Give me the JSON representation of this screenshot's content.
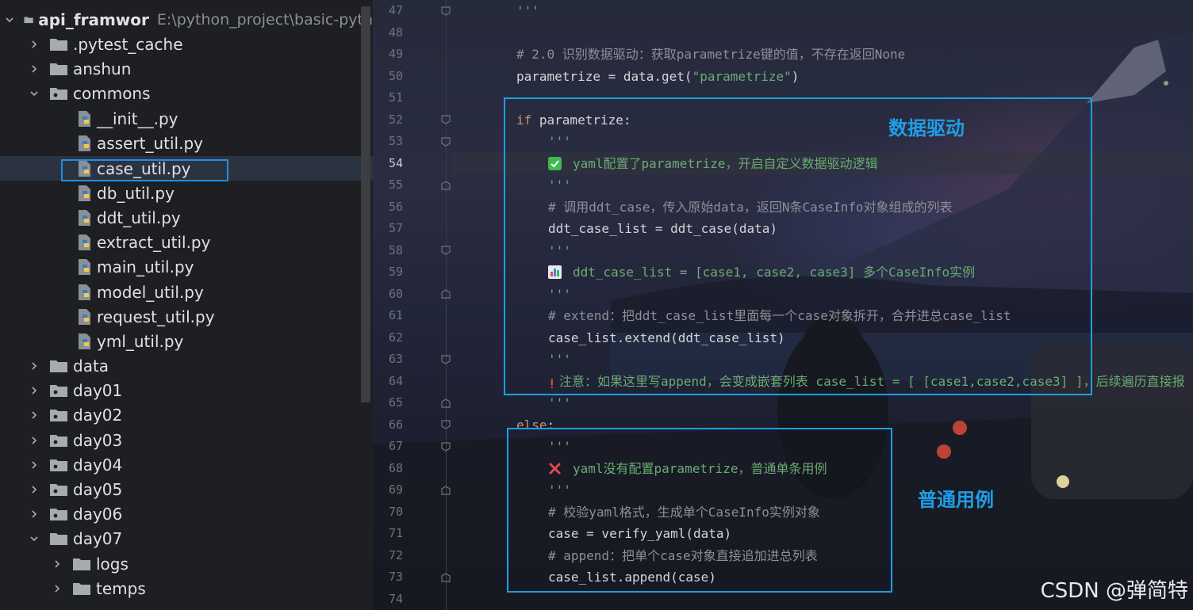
{
  "tree": {
    "root": {
      "name": "api_framwor",
      "path": "E:\\python_project\\basic-pyth"
    },
    "items": [
      {
        "label": ".pytest_cache",
        "kind": "folder"
      },
      {
        "label": "anshun",
        "kind": "folder"
      },
      {
        "label": "commons",
        "kind": "folder",
        "expanded": true
      },
      {
        "label": "__init__.py",
        "kind": "python-file"
      },
      {
        "label": "assert_util.py",
        "kind": "python-file"
      },
      {
        "label": "case_util.py",
        "kind": "python-file",
        "selected": true
      },
      {
        "label": "db_util.py",
        "kind": "python-file"
      },
      {
        "label": "ddt_util.py",
        "kind": "python-file"
      },
      {
        "label": "extract_util.py",
        "kind": "python-file"
      },
      {
        "label": "main_util.py",
        "kind": "python-file"
      },
      {
        "label": "model_util.py",
        "kind": "python-file"
      },
      {
        "label": "request_util.py",
        "kind": "python-file"
      },
      {
        "label": "yml_util.py",
        "kind": "python-file"
      },
      {
        "label": "data",
        "kind": "folder"
      },
      {
        "label": "day01",
        "kind": "folder"
      },
      {
        "label": "day02",
        "kind": "folder"
      },
      {
        "label": "day03",
        "kind": "folder"
      },
      {
        "label": "day04",
        "kind": "folder"
      },
      {
        "label": "day05",
        "kind": "folder"
      },
      {
        "label": "day06",
        "kind": "folder"
      },
      {
        "label": "day07",
        "kind": "folder",
        "expanded": true
      },
      {
        "label": "logs",
        "kind": "folder"
      },
      {
        "label": "temps",
        "kind": "folder"
      }
    ]
  },
  "editor": {
    "lines": [
      {
        "n": "47",
        "text": "'''"
      },
      {
        "n": "48",
        "text": ""
      },
      {
        "n": "49",
        "text": "# 2.0 识别数据驱动：获取parametrize键的值，不存在返回None"
      },
      {
        "n": "50",
        "text_a": "parametrize = data.get(",
        "text_b": "\"parametrize\"",
        "text_c": ")"
      },
      {
        "n": "51",
        "text": ""
      },
      {
        "n": "52",
        "kw": "if",
        "text": " parametrize:"
      },
      {
        "n": "53",
        "text": "'''"
      },
      {
        "n": "54",
        "text": "yaml配置了parametrize，开启自定义数据驱动逻辑"
      },
      {
        "n": "55",
        "text": "'''"
      },
      {
        "n": "56",
        "text": "# 调用ddt_case，传入原始data，返回N条CaseInfo对象组成的列表"
      },
      {
        "n": "57",
        "text": "ddt_case_list = ddt_case(data)"
      },
      {
        "n": "58",
        "text": "'''"
      },
      {
        "n": "59",
        "text": "ddt_case_list = [case1, case2, case3] 多个CaseInfo实例"
      },
      {
        "n": "60",
        "text": "'''"
      },
      {
        "n": "61",
        "text": "# extend：把ddt_case_list里面每一个case对象拆开，合并进总case_list"
      },
      {
        "n": "62",
        "text": "case_list.extend(ddt_case_list)"
      },
      {
        "n": "63",
        "text": "'''"
      },
      {
        "n": "64",
        "text": "注意：如果这里写append，会变成嵌套列表 case_list = [ [case1,case2,case3] ]，后续遍历直接报"
      },
      {
        "n": "65",
        "text": "'''"
      },
      {
        "n": "66",
        "kw": "else",
        "text": ":"
      },
      {
        "n": "67",
        "text": "'''"
      },
      {
        "n": "68",
        "text": "yaml没有配置parametrize，普通单条用例"
      },
      {
        "n": "69",
        "text": "'''"
      },
      {
        "n": "70",
        "text": "# 校验yaml格式，生成单个CaseInfo实例对象"
      },
      {
        "n": "71",
        "text": "case = verify_yaml(data)"
      },
      {
        "n": "72",
        "text": "# append：把单个case对象直接追加进总列表"
      },
      {
        "n": "73",
        "text": "case_list.append(case)"
      },
      {
        "n": "74",
        "text": ""
      }
    ],
    "annotations": {
      "data_driven": "数据驱动",
      "normal_case": "普通用例"
    },
    "icons": {
      "check": "check-mark-icon",
      "chart": "bar-chart-icon",
      "warning": "exclamation-icon",
      "cross": "cross-mark-icon"
    },
    "accent": "#1e9ee6"
  },
  "watermark": "CSDN @弹简特"
}
